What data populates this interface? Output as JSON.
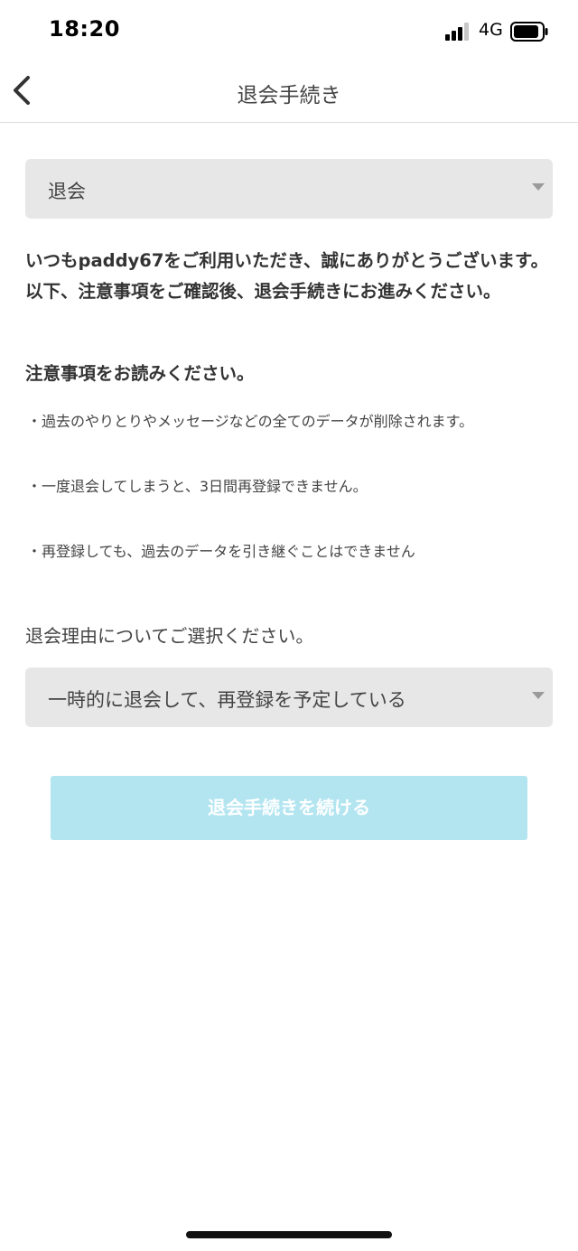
{
  "status_bar": {
    "time": "18:20",
    "network": "4G",
    "signal_icon": "cellular-signal-icon",
    "battery_icon": "battery-icon"
  },
  "nav": {
    "back_icon": "chevron-left-icon",
    "title": "退会手続き"
  },
  "top_select": {
    "value": "退会",
    "icon": "caret-down-icon"
  },
  "intro_text": "いつもpaddy67をご利用いただき、誠にありがとうございます。 以下、注意事項をご確認後、退会手続きにお進みください。",
  "notice": {
    "heading": "注意事項をお読みください。",
    "items": [
      "・過去のやりとりやメッセージなどの全てのデータが削除されます。",
      "・一度退会してしまうと、3日間再登録できません。",
      "・再登録しても、過去のデータを引き継ぐことはできません"
    ]
  },
  "reason": {
    "label": "退会理由についてご選択ください。",
    "selected": "一時的に退会して、再登録を予定している",
    "icon": "caret-down-icon"
  },
  "submit_label": "退会手続きを続ける",
  "colors": {
    "accent": "#b3e5f1",
    "select_bg": "#e7e7e7",
    "text": "#333333"
  }
}
